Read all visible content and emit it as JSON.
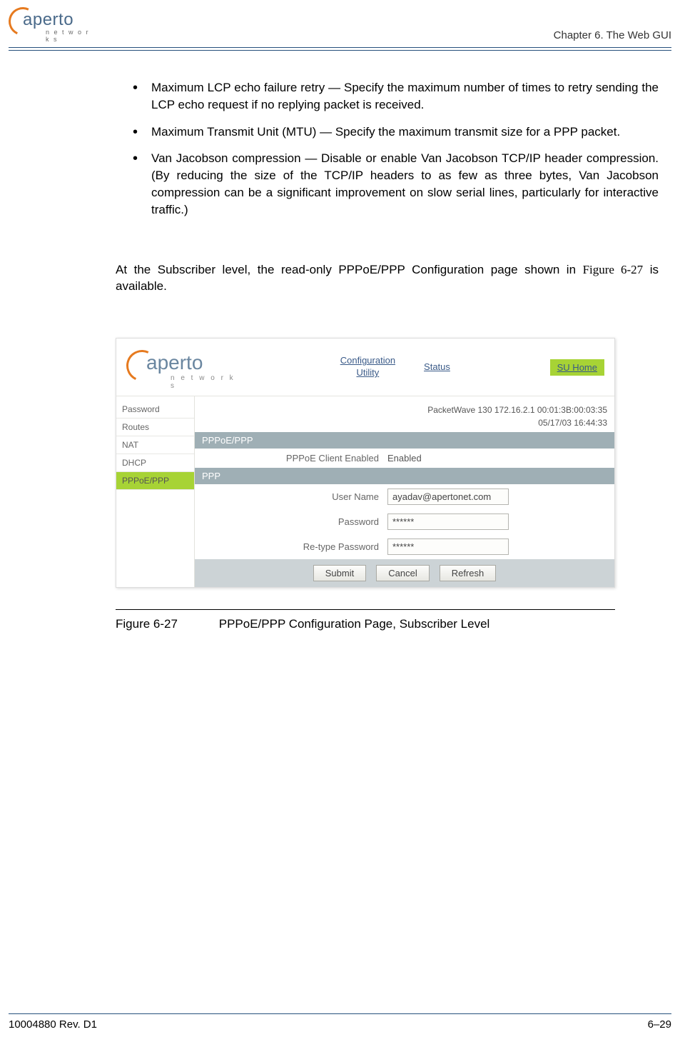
{
  "header": {
    "logo_text": "aperto",
    "logo_sub": "n e t w o r k s",
    "chapter": "Chapter 6.  The Web GUI"
  },
  "bullets": [
    "Maximum LCP echo failure retry — Specify the maximum number of times to retry sending the LCP echo request if no replying packet is received.",
    "Maximum Transmit Unit (MTU) — Specify the maximum transmit size for a PPP packet.",
    "Van Jacobson compression — Disable or enable Van Jacobson TCP/IP header compression. (By reducing the size of the TCP/IP headers to as few as three bytes, Van Jacobson compression can be a significant improvement on slow serial lines, particularly for interactive traffic.)"
  ],
  "paragraph_pre": "At the Subscriber level, the read-only PPPoE/PPP Configuration page shown in ",
  "paragraph_ref": "Figure 6-27",
  "paragraph_post": " is available.",
  "screenshot": {
    "logo_text": "aperto",
    "logo_sub": "n e t w o r k s",
    "nav": {
      "config": "Configuration Utility",
      "status": "Status",
      "su_home": "SU Home"
    },
    "sidebar": [
      "Password",
      "Routes",
      "NAT",
      "DHCP",
      "PPPoE/PPP"
    ],
    "sidebar_active_index": 4,
    "meta_line1": "PacketWave 130    172.16.2.1    00:01:3B:00:03:35",
    "meta_line2": "05/17/03    16:44:33",
    "section1_header": "PPPoE/PPP",
    "row_client_label": "PPPoE Client Enabled",
    "row_client_value": "Enabled",
    "section2_header": "PPP",
    "row_user_label": "User Name",
    "row_user_value": "ayadav@apertonet.com",
    "row_pass_label": "Password",
    "row_pass_value": "******",
    "row_repass_label": "Re-type Password",
    "row_repass_value": "******",
    "btn_submit": "Submit",
    "btn_cancel": "Cancel",
    "btn_refresh": "Refresh"
  },
  "figure": {
    "num": "Figure 6-27",
    "caption": "PPPoE/PPP Configuration Page, Subscriber Level"
  },
  "footer": {
    "left": "10004880 Rev. D1",
    "right": "6–29"
  }
}
